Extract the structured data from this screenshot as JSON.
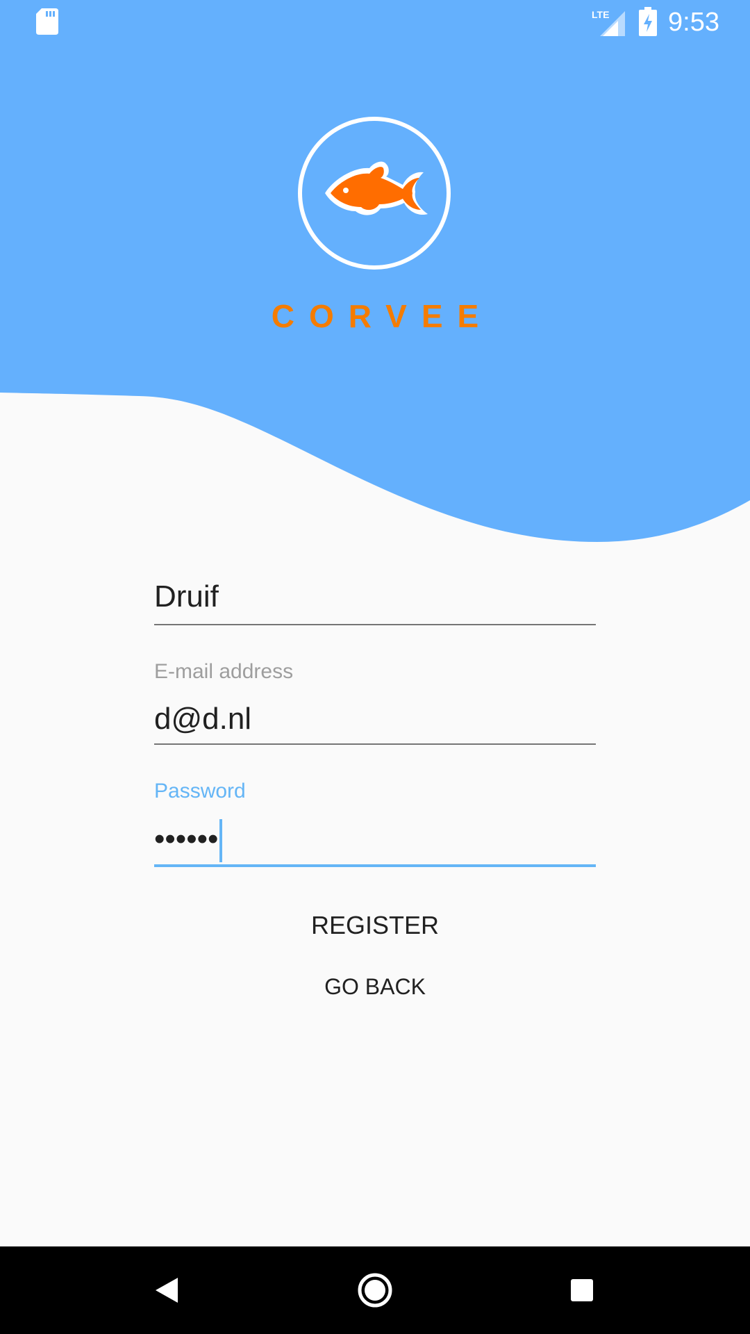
{
  "colors": {
    "hero_blue": "#64B0FD",
    "brand_orange": "#F57C00",
    "accent_focus": "#64B5F6",
    "background": "#FAFAFA",
    "nav_bar": "#000000"
  },
  "status_bar": {
    "time": "9:53",
    "icons": [
      "sd-card-icon",
      "lte-signal-icon",
      "battery-charging-icon"
    ]
  },
  "brand": {
    "logo_icon": "goldfish-icon",
    "name": "CORVEE"
  },
  "form": {
    "name_field": {
      "value": "Druif"
    },
    "email_field": {
      "label": "E-mail address",
      "value": "d@d.nl"
    },
    "password_field": {
      "label": "Password",
      "value": "••••••",
      "focused": true
    }
  },
  "actions": {
    "register_label": "REGISTER",
    "go_back_label": "GO BACK"
  },
  "nav_bar": {
    "buttons": [
      "back-icon",
      "home-icon",
      "recents-icon"
    ]
  }
}
